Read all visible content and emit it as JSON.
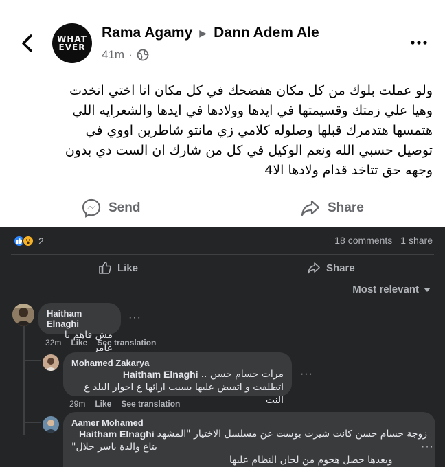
{
  "post": {
    "author": "Rama Agamy",
    "target": "Dann Adem Ale",
    "time": "41m",
    "avatar_text": [
      "WHAT",
      "EVER"
    ],
    "text_lines": [
      "ولو عملت بلوك من كل مكان هفضحك في كل مكان انا اختي اتخدت",
      "وهيا علي زمتك  وقسيمتها في ايدها وولادها في ايدها والشعرايه اللي",
      "هتمسها هتدمرك قبلها وصلوله كلامي زي مانتو شاطرين اووي في",
      "توصيل حسبي الله ونعم الوكيل في كل من شارك ان الست دي بدون",
      "وجهه حق تتاخد قدام ولادها الا4"
    ],
    "send_label": "Send",
    "share_label": "Share",
    "back_icon": "chevron-left-icon",
    "privacy_icon": "globe-icon",
    "more_icon": "more-dots-icon"
  },
  "engagement": {
    "reaction_count": "2",
    "comments": "18 comments",
    "shares": "1 share",
    "like_label": "Like",
    "share_label": "Share",
    "sort_label": "Most relevant"
  },
  "comments": [
    {
      "author": "Haitham Elnaghi",
      "text": "مش فاهم يا عامر",
      "time": "32m",
      "like": "Like",
      "translate": "See translation"
    },
    {
      "author": "Mohamed Zakarya",
      "mention": "Haitham Elnaghi",
      "line1": "مرات حسام حسن ..",
      "line2": "اتطلقت و اتقبض عليها بسبب ارائها ع احوار البلد ع النت",
      "time": "29m",
      "like": "Like",
      "translate": "See translation"
    },
    {
      "author": "Aamer Mohamed",
      "mention": "Haitham Elnaghi",
      "line1": "زوجة حسام حسن كانت شيرت بوست عن مسلسل الاختيار \"المشهد",
      "line2": "بتاع والدة ياسر جلال\"",
      "line3": "وبعدها حصل هجوم من لجان النظام عليها"
    }
  ],
  "colors": {
    "dark_bg": "#242526",
    "bubble_bg": "#3a3b3c",
    "like_blue": "#2d88ff",
    "wow_yellow": "#f7b125"
  }
}
